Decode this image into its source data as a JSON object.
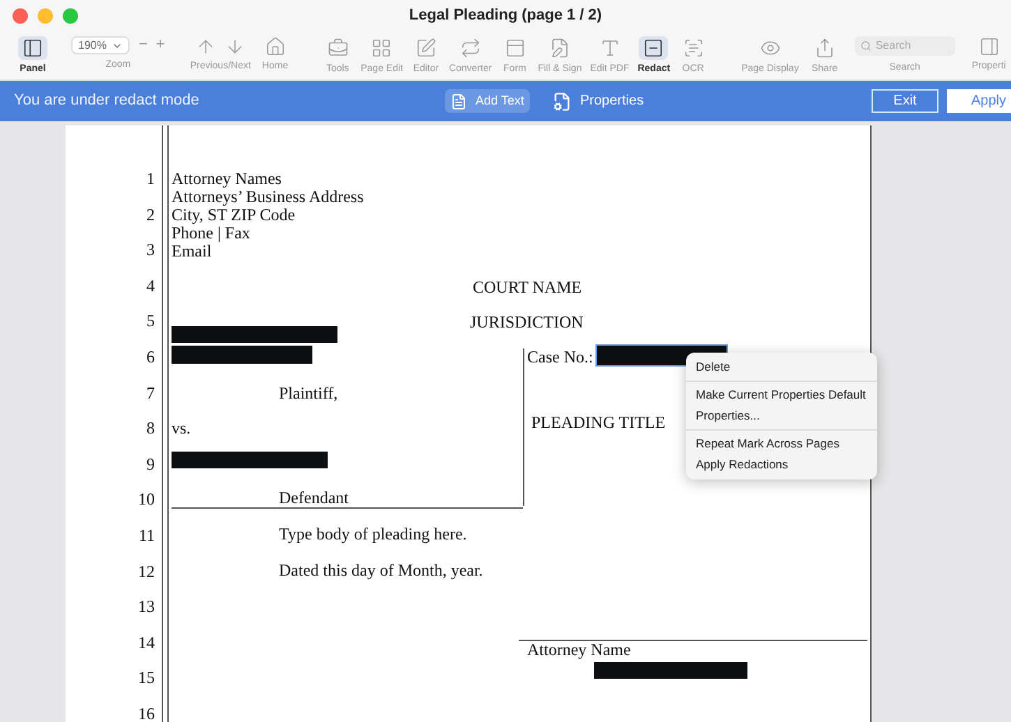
{
  "window": {
    "title": "Legal Pleading (page 1 / 2)"
  },
  "toolbar": {
    "left": [
      {
        "label": "Panel",
        "selected": true
      }
    ],
    "zoom": {
      "value": "190%",
      "minus": "−",
      "plus": "+",
      "label": "Zoom"
    },
    "nav": {
      "label": "Previous/Next"
    },
    "home": {
      "label": "Home"
    },
    "tools": [
      {
        "label": "Tools",
        "selected": false
      },
      {
        "label": "Page Edit",
        "selected": false
      },
      {
        "label": "Editor",
        "selected": false
      },
      {
        "label": "Converter",
        "selected": false
      },
      {
        "label": "Form",
        "selected": false
      },
      {
        "label": "Fill & Sign",
        "selected": false
      },
      {
        "label": "Edit PDF",
        "selected": false
      },
      {
        "label": "Redact",
        "selected": true
      },
      {
        "label": "OCR",
        "selected": false
      }
    ],
    "view": [
      {
        "label": "Page Display"
      },
      {
        "label": "Share"
      }
    ],
    "search": {
      "placeholder": "Search",
      "label": "Search"
    },
    "properties": {
      "label": "Properti"
    }
  },
  "redact_bar": {
    "message": "You are under redact mode",
    "add_text": "Add Text",
    "properties": "Properties",
    "exit": "Exit",
    "apply": "Apply"
  },
  "document": {
    "line_numbers": [
      "1",
      "2",
      "3",
      "4",
      "5",
      "6",
      "7",
      "8",
      "9",
      "10",
      "11",
      "12",
      "13",
      "14",
      "15",
      "16"
    ],
    "address": [
      "Attorney Names",
      "Attorneys’ Business Address",
      "City, ST ZIP Code",
      "Phone | Fax",
      "Email"
    ],
    "court": "COURT NAME",
    "jurisdiction": "JURISDICTION",
    "case_no": "Case No.:",
    "case_redaction_selected": true,
    "plaintiff": "Plaintiff,",
    "vs": "vs.",
    "pleading_title": "PLEADING TITLE",
    "defendant": "Defendant",
    "body": "Type body of pleading here.",
    "dated": "Dated this day of Month, year.",
    "attorney_name": "Attorney Name"
  },
  "context_menu": [
    [
      "Delete"
    ],
    [
      "Make Current Properties Default",
      "Properties..."
    ],
    [
      "Repeat Mark Across Pages",
      "Apply Redactions"
    ]
  ]
}
